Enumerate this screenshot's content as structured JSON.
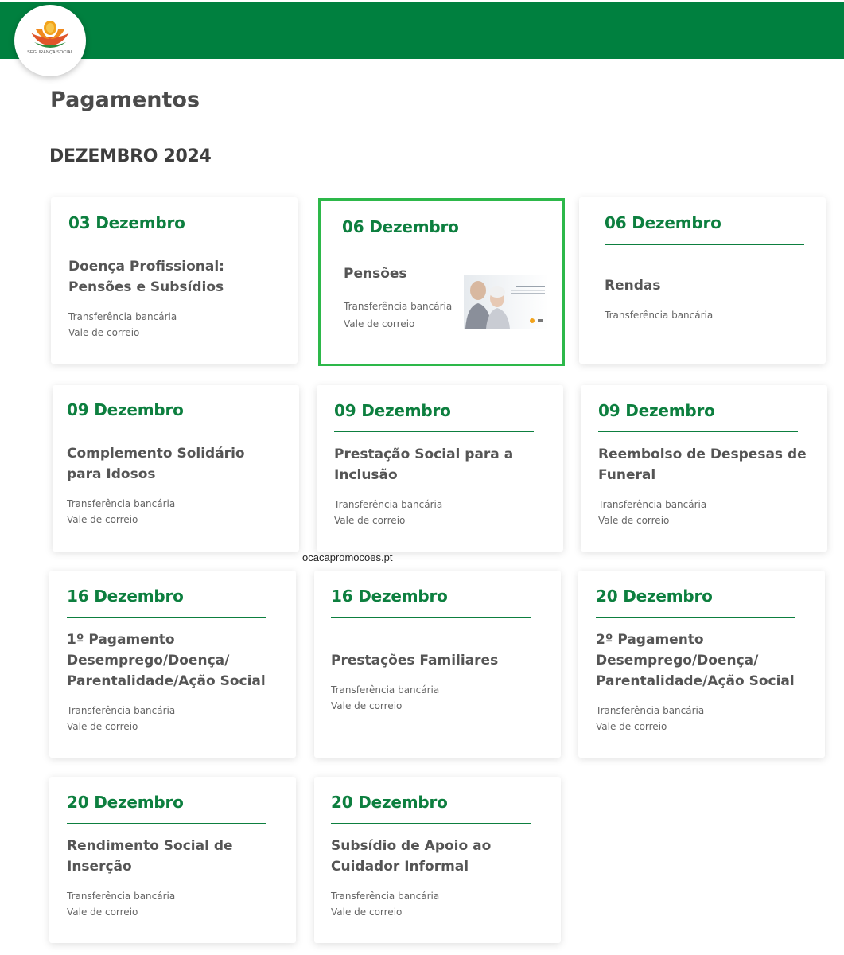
{
  "header": {
    "logo_text": "SEGURANÇA SOCIAL",
    "brand_color": "#00803f"
  },
  "page_title": "Pagamentos",
  "month_heading": "DEZEMBRO 2024",
  "cards": [
    {
      "date": "03 Dezembro",
      "title": "Doença Profissional: Pensões e Subsídios",
      "methods": [
        "Transferência bancária",
        "Vale de correio"
      ]
    },
    {
      "date": "06 Dezembro",
      "title": "Pensões",
      "methods": [
        "Transferência bancária",
        "Vale de correio"
      ]
    },
    {
      "date": "06 Dezembro",
      "title": "Rendas",
      "methods": [
        "Transferência bancária"
      ]
    },
    {
      "date": "09 Dezembro",
      "title": "Complemento Solidário para Idosos",
      "methods": [
        "Transferência bancária",
        "Vale de correio"
      ]
    },
    {
      "date": "09 Dezembro",
      "title": "Prestação Social para a Inclusão",
      "methods": [
        "Transferência bancária",
        "Vale de correio"
      ]
    },
    {
      "date": "09 Dezembro",
      "title": "Reembolso de Despesas de Funeral",
      "methods": [
        "Transferência bancária",
        "Vale de correio"
      ]
    },
    {
      "date": "16 Dezembro",
      "title": "1º Pagamento Desemprego/Doença/ Parentalidade/Ação Social",
      "methods": [
        "Transferência bancária",
        "Vale de correio"
      ]
    },
    {
      "date": "16 Dezembro",
      "title": "Prestações Familiares",
      "methods": [
        "Transferência bancária",
        "Vale de correio"
      ]
    },
    {
      "date": "20 Dezembro",
      "title": "2º Pagamento Desemprego/Doença/ Parentalidade/Ação Social",
      "methods": [
        "Transferência bancária",
        "Vale de correio"
      ]
    },
    {
      "date": "20 Dezembro",
      "title": "Rendimento Social de Inserção",
      "methods": [
        "Transferência bancária",
        "Vale de correio"
      ]
    },
    {
      "date": "20 Dezembro",
      "title": "Subsídio de Apoio ao Cuidador Informal",
      "methods": [
        "Transferência bancária",
        "Vale de correio"
      ]
    }
  ],
  "watermark": "ocacapromocoes.pt"
}
